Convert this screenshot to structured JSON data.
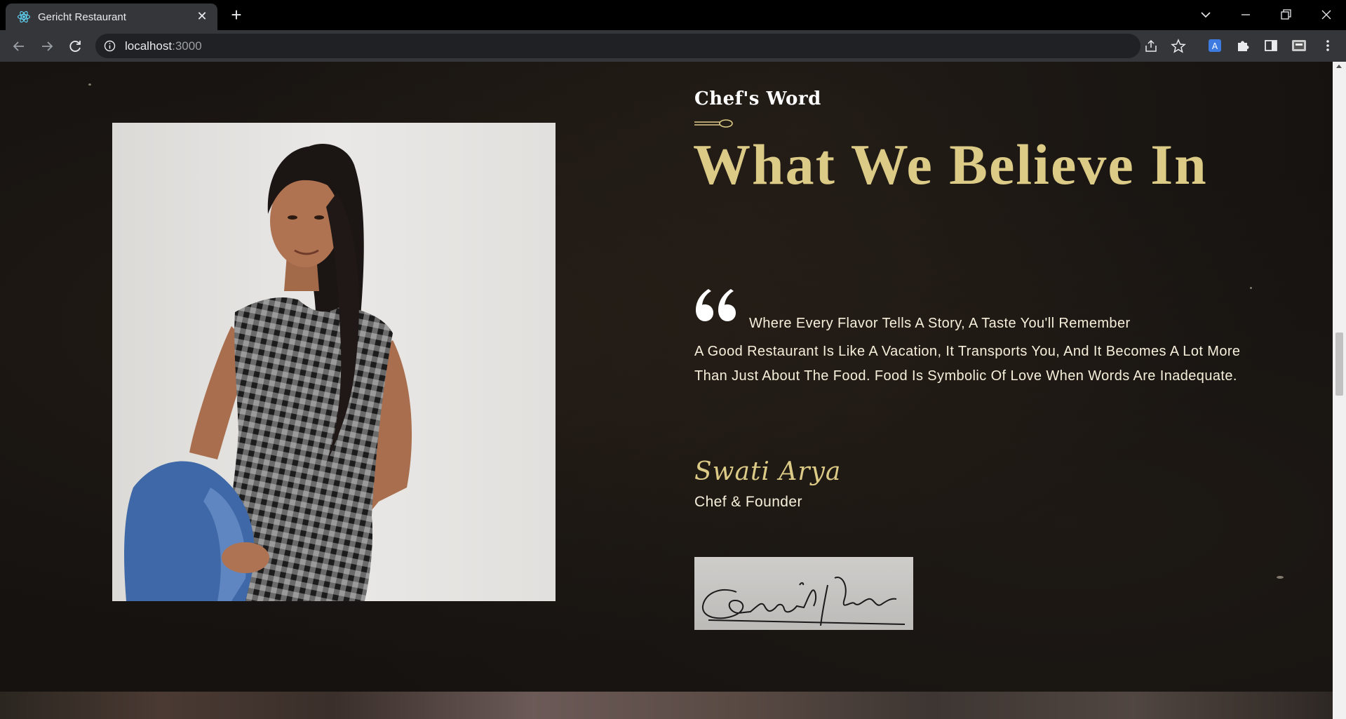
{
  "browser": {
    "tab_title": "Gericht Restaurant",
    "url_host": "localhost",
    "url_port": ":3000"
  },
  "about_chef": {
    "subtitle": "Chef's Word",
    "headline": "What We Believe In",
    "quote_lead": "Where Every Flavor Tells A Story, A Taste You'll Remember",
    "quote_body": "A Good Restaurant Is Like A Vacation, It Transports You, And It Becomes A Lot More Than Just About The Food. Food Is Symbolic Of Love When Words Are Inadequate.",
    "chef_name": "Swati Arya",
    "chef_role": "Chef & Founder",
    "signature_text": "Swati Arya"
  },
  "colors": {
    "accent_gold": "#dcca87",
    "text_cream": "#f5efdb",
    "page_bg": "#151210"
  }
}
